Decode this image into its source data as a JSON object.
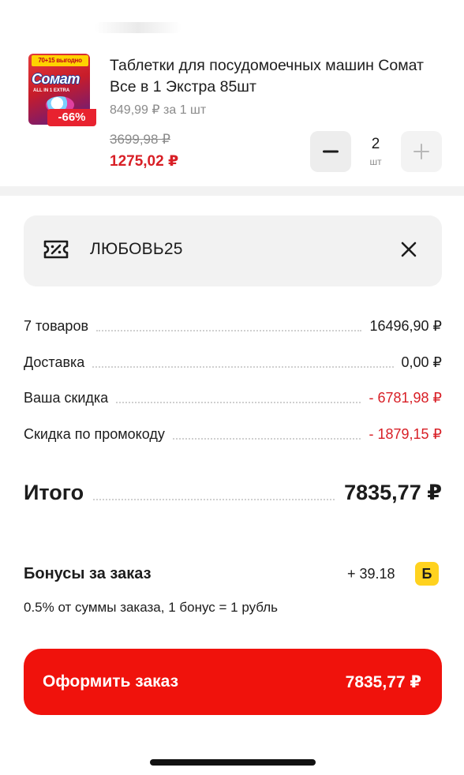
{
  "item": {
    "image_badge_top": "70+15 выгодно",
    "image_brand": "Сомат",
    "image_sub": "ALL IN 1 EXTRA",
    "discount_badge": "-66%",
    "title": "Таблетки для посудомоечных машин Сомат Все в 1 Экстра 85шт",
    "unit_price": "849,99 ₽ за 1 шт",
    "old_price": "3699,98 ₽",
    "new_price": "1275,02 ₽",
    "quantity": "2",
    "quantity_unit": "шт",
    "minus_icon": "minus-icon",
    "plus_icon": "plus-icon"
  },
  "promo": {
    "icon": "coupon-icon",
    "code": "ЛЮБОВЬ25",
    "close_icon": "close-icon"
  },
  "summary": {
    "rows": [
      {
        "label": "7 товаров",
        "value": "16496,90 ₽",
        "red": false
      },
      {
        "label": "Доставка",
        "value": "0,00 ₽",
        "red": false
      },
      {
        "label": "Ваша скидка",
        "value": "- 6781,98 ₽",
        "red": true
      },
      {
        "label": "Скидка по промокоду",
        "value": "- 1879,15 ₽",
        "red": true
      }
    ],
    "total_label": "Итого",
    "total_value": "7835,77 ₽"
  },
  "bonus": {
    "title": "Бонусы за заказ",
    "value": "+ 39.18",
    "badge": "Б",
    "note": "0.5% от суммы заказа, 1 бонус = 1 рубль"
  },
  "checkout": {
    "label": "Оформить заказ",
    "value": "7835,77 ₽"
  },
  "colors": {
    "accent_red": "#f0120c",
    "price_red": "#d81f26",
    "bonus_yellow": "#ffd21f"
  }
}
